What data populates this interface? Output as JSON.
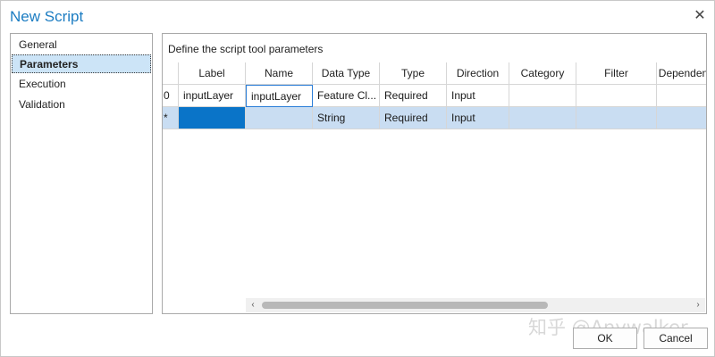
{
  "window": {
    "title": "New Script",
    "close_glyph": "✕"
  },
  "nav": {
    "items": [
      {
        "label": "General"
      },
      {
        "label": "Parameters",
        "selected": true
      },
      {
        "label": "Execution"
      },
      {
        "label": "Validation"
      }
    ]
  },
  "content": {
    "header": "Define the script tool parameters",
    "columns": [
      "Label",
      "Name",
      "Data Type",
      "Type",
      "Direction",
      "Category",
      "Filter",
      "Dependen"
    ],
    "rows": [
      {
        "marker": "0",
        "cells": [
          "inputLayer",
          "inputLayer",
          "Feature Cl...",
          "Required",
          "Input",
          "",
          "",
          ""
        ]
      },
      {
        "marker": "*",
        "cells": [
          "",
          "",
          "String",
          "Required",
          "Input",
          "",
          "",
          ""
        ]
      }
    ]
  },
  "scrollbar": {
    "left_arrow": "‹",
    "right_arrow": "›"
  },
  "watermark": "知乎 @Anywalker",
  "buttons": {
    "ok": "OK",
    "cancel": "Cancel"
  },
  "colors": {
    "accent": "#1b7cc2",
    "selection": "#0a74c8",
    "row_highlight": "#c9ddf2"
  }
}
